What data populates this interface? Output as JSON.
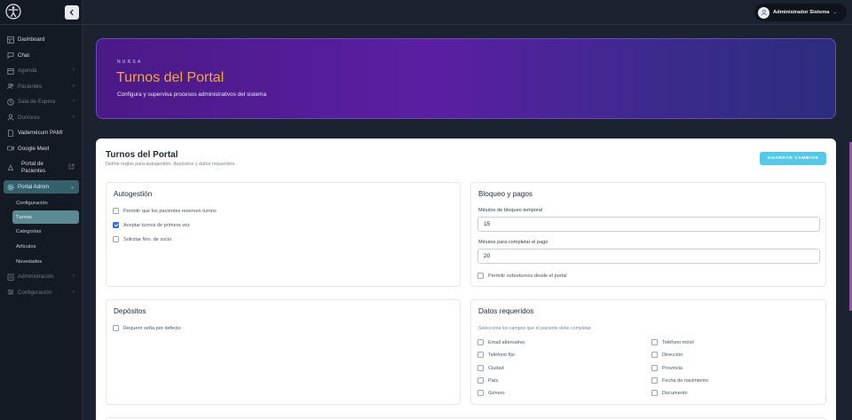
{
  "sidebar": {
    "items": [
      {
        "label": "Dashboard",
        "icon": "dashboard-icon",
        "dim": false,
        "chevron": false
      },
      {
        "label": "Chat",
        "icon": "chat-icon",
        "dim": false,
        "chevron": false
      },
      {
        "label": "Agenda",
        "icon": "calendar-icon",
        "dim": true,
        "chevron": true
      },
      {
        "label": "Pacientes",
        "icon": "users-icon",
        "dim": true,
        "chevron": true
      },
      {
        "label": "Sala de Espera",
        "icon": "clock-icon",
        "dim": true,
        "chevron": true
      },
      {
        "label": "Doctores",
        "icon": "doctor-icon",
        "dim": true,
        "chevron": true
      },
      {
        "label": "Vademécum PAMI",
        "icon": "document-icon",
        "dim": false,
        "chevron": false
      },
      {
        "label": "Google Meet",
        "icon": "video-icon",
        "dim": false,
        "chevron": false
      }
    ],
    "portal_pacientes": {
      "line1": "Portal de",
      "line2": "Pacientes",
      "icon": "external-link-icon"
    },
    "portal_admin": {
      "label": "Portal Admin",
      "icon": "gear-icon"
    },
    "sub_items": [
      "Configuración",
      "Turnos",
      "Categorías",
      "Artículos",
      "Novedades"
    ],
    "active_sub": "Turnos",
    "bottom_items": [
      {
        "label": "Administración",
        "icon": "building-icon"
      },
      {
        "label": "Configuración",
        "icon": "sliders-icon"
      }
    ]
  },
  "topbar": {
    "user_name": "Administrador Sistema"
  },
  "banner": {
    "eyebrow": "NURSA",
    "title": "Turnos del Portal",
    "subtitle": "Configura y supervisa procesos administrativos del sistema"
  },
  "card": {
    "title": "Turnos del Portal",
    "subtitle": "Define reglas para autogestión, depósitos y datos requeridos.",
    "save_label": "GUARDAR CAMBIOS"
  },
  "autogestion": {
    "title": "Autogestión",
    "options": [
      {
        "label": "Permitir que los pacientes reserven turnos",
        "checked": false
      },
      {
        "label": "Aceptar turnos de primera vez",
        "checked": true
      },
      {
        "label": "Solicitar Nro. de socio",
        "checked": false
      }
    ]
  },
  "bloqueo": {
    "title": "Bloqueo y pagos",
    "min_bloqueo_label": "Minutos de bloqueo temporal",
    "min_bloqueo_value": "15",
    "min_pago_label": "Minutos para completar el pago",
    "min_pago_value": "20",
    "sobreturnos_label": "Permitir sobreturnos desde el portal",
    "sobreturnos_checked": false
  },
  "depositos": {
    "title": "Depósitos",
    "option_label": "Requerir seña por defecto",
    "checked": false
  },
  "datos": {
    "title": "Datos requeridos",
    "hint": "Selecciona los campos que el paciente debe completar.",
    "left": [
      "Email alternativo",
      "Teléfono fijo",
      "Ciudad",
      "País",
      "Género"
    ],
    "right": [
      "Teléfono móvil",
      "Dirección",
      "Provincia",
      "Fecha de nacimiento",
      "Documento"
    ]
  },
  "colors": {
    "accent": "#58c8e8",
    "banner_title": "#f3a63a",
    "sidebar_active": "#355f6a"
  }
}
